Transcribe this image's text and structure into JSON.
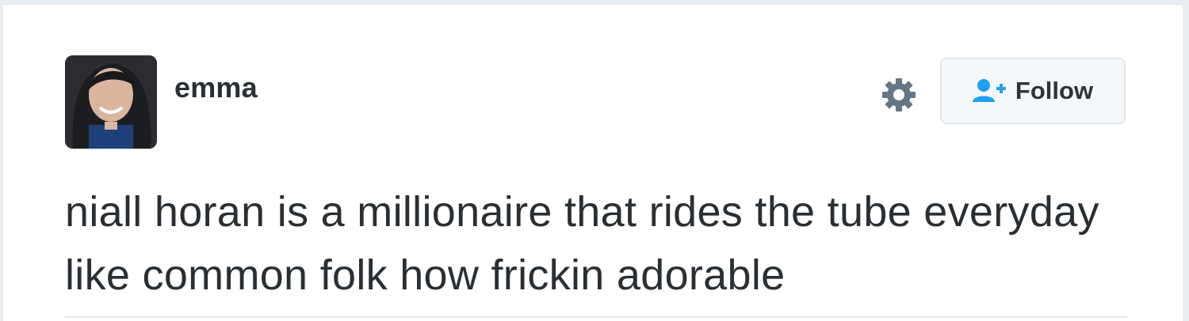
{
  "tweet": {
    "author": {
      "name": "emma"
    },
    "text": "niall horan is a millionaire that rides the tube everyday like common folk how frickin adorable"
  },
  "actions": {
    "follow_label": "Follow",
    "settings_icon": "gear-icon",
    "follow_icon": "add-user-icon"
  },
  "colors": {
    "accent": "#1da1f2",
    "text": "#292f33",
    "icon": "#657786"
  }
}
